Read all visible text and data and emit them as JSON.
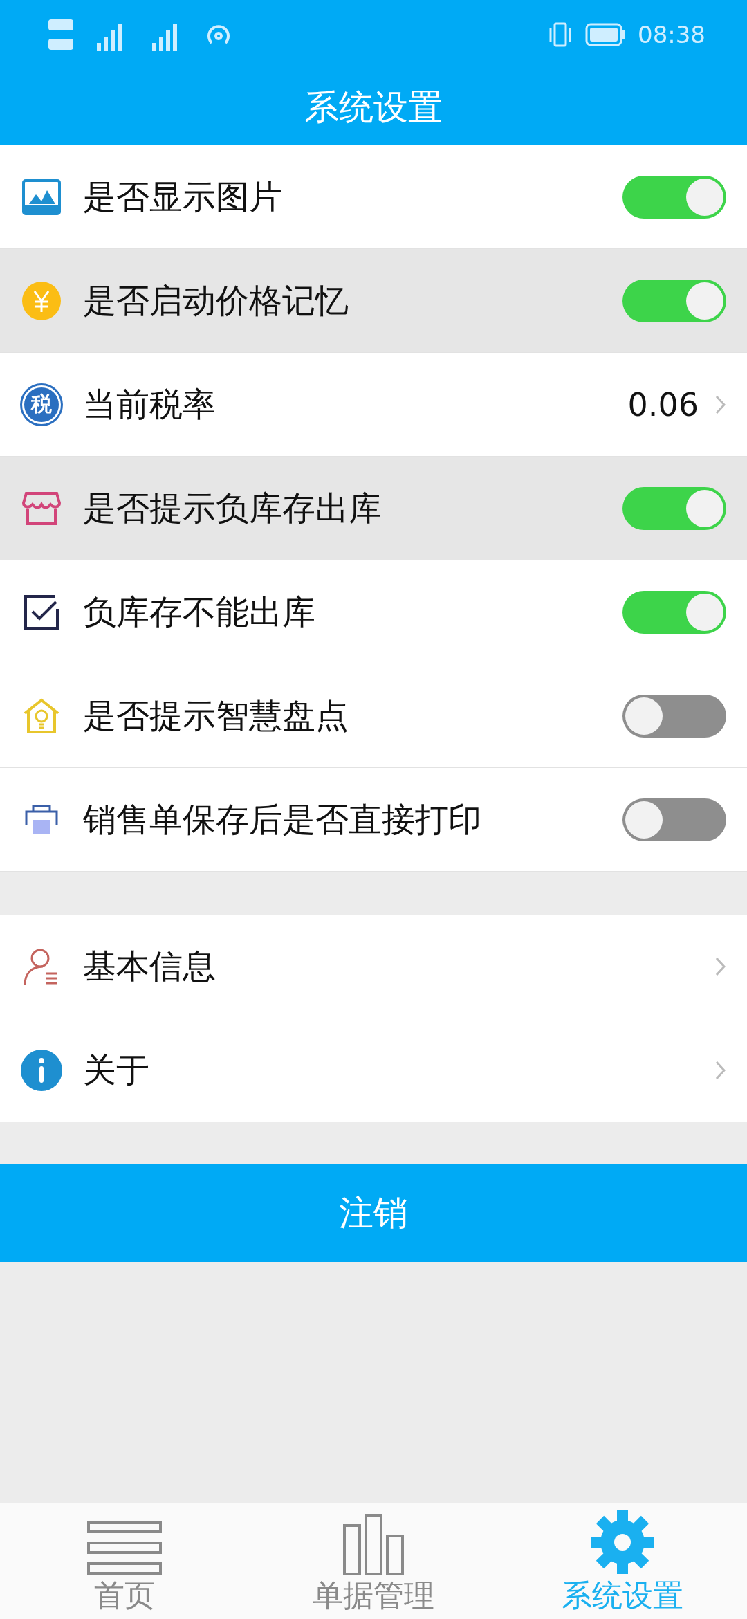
{
  "status_bar": {
    "time": "08:38"
  },
  "header": {
    "title": "系统设置"
  },
  "settings": [
    {
      "kind": "toggle",
      "label": "是否显示图片",
      "on": true,
      "highlighted": false
    },
    {
      "kind": "toggle",
      "label": "是否启动价格记忆",
      "on": true,
      "highlighted": true
    },
    {
      "kind": "value",
      "icon_text": "税",
      "label": "当前税率",
      "value": "0.06",
      "highlighted": false
    },
    {
      "kind": "toggle",
      "label": "是否提示负库存出库",
      "on": true,
      "highlighted": true
    },
    {
      "kind": "toggle",
      "label": "负库存不能出库",
      "on": true,
      "highlighted": false
    },
    {
      "kind": "toggle",
      "label": "是否提示智慧盘点",
      "on": false,
      "highlighted": false
    },
    {
      "kind": "toggle",
      "label": "销售单保存后是否直接打印",
      "on": false,
      "highlighted": false
    }
  ],
  "links": [
    {
      "label": "基本信息"
    },
    {
      "label": "关于"
    }
  ],
  "logout_button": "注销",
  "tabs": [
    {
      "label": "首页",
      "selected": false
    },
    {
      "label": "单据管理",
      "selected": false
    },
    {
      "label": "系统设置",
      "selected": true
    }
  ]
}
